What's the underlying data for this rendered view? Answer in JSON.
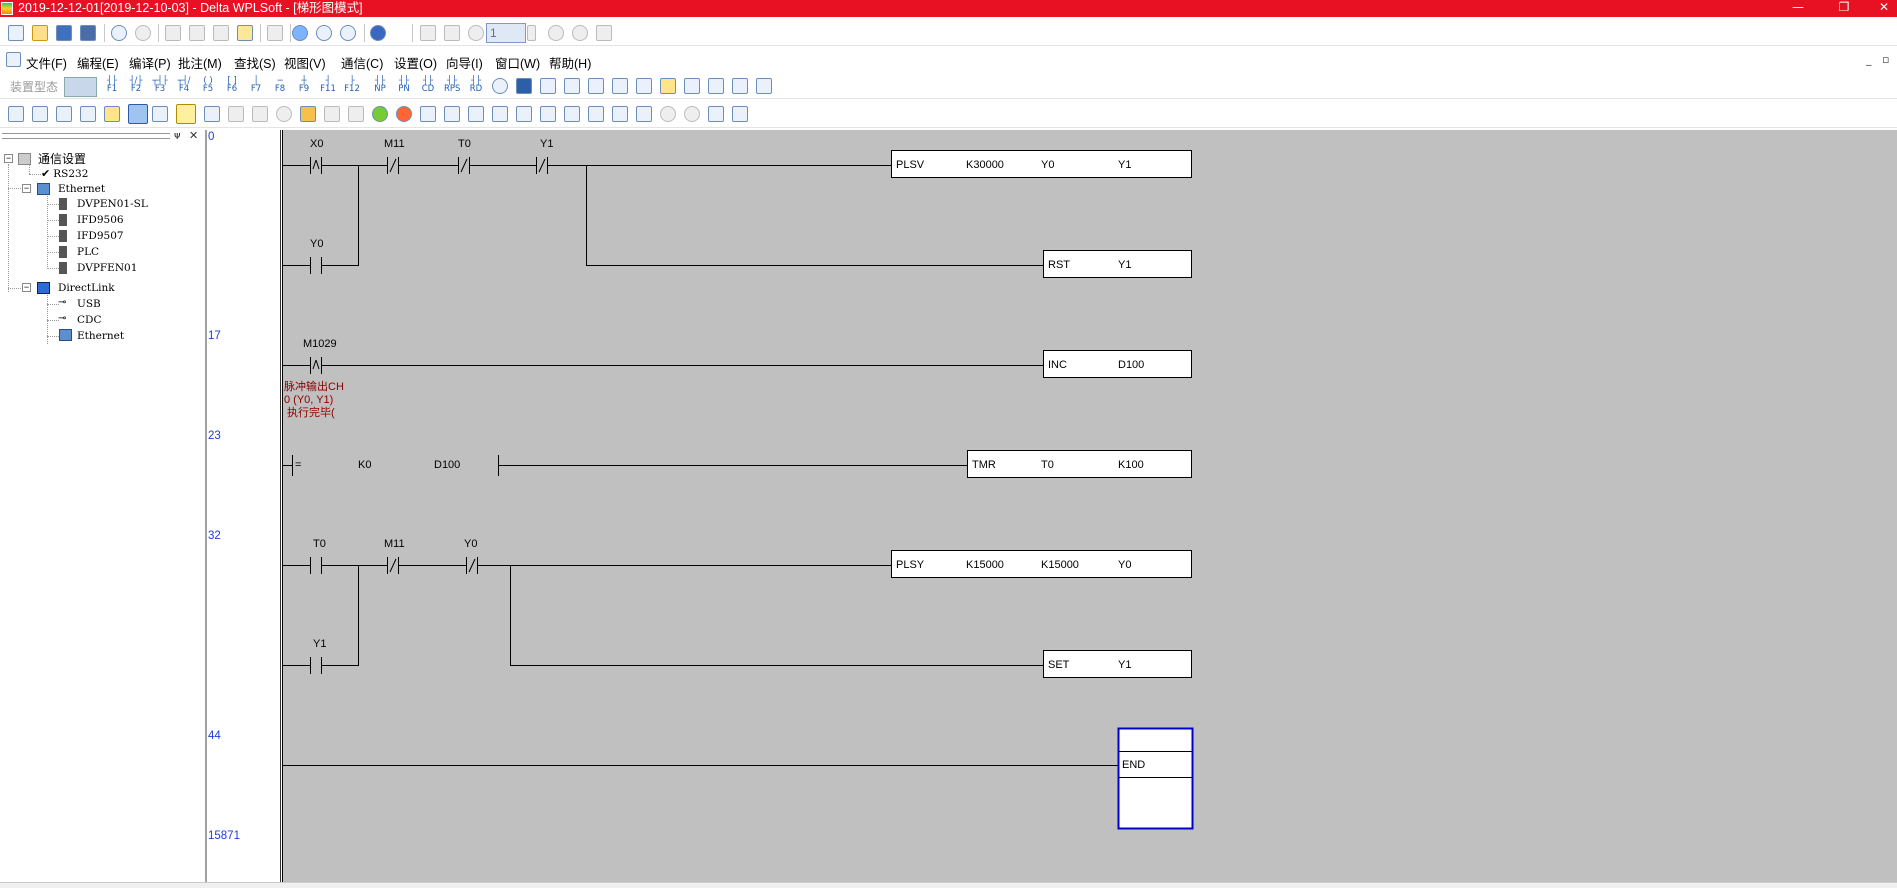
{
  "window": {
    "title": "2019-12-12-01[2019-12-10-03] - Delta WPLSoft - [梯形图模式]",
    "minimize": "—",
    "restore": "❐",
    "close": "✕"
  },
  "toolbar": {
    "position_value": "1"
  },
  "menu": {
    "items": [
      "文件(F)",
      "编程(E)",
      "编译(P)",
      "批注(M)",
      "查找(S)",
      "视图(V)",
      "通信(C)",
      "设置(O)",
      "向导(I)",
      "窗口(W)",
      "帮助(H)"
    ],
    "mdi_min": "_",
    "mdi_restore": "▫"
  },
  "function_bar": {
    "device_type_label": "装置型态",
    "fkeys": [
      "F1",
      "F2",
      "F3",
      "F4",
      "F5",
      "F6",
      "F7",
      "F8",
      "F9",
      "F11",
      "F12",
      "NP",
      "PN",
      "CD",
      "RPS",
      "RD"
    ]
  },
  "comm_tree": {
    "header_pin": "ᴪ",
    "header_close": "✕",
    "root": "通信设置",
    "items": [
      {
        "label": "RS232"
      },
      {
        "label": "Ethernet"
      },
      {
        "label": "DVPEN01-SL"
      },
      {
        "label": "IFD9506"
      },
      {
        "label": "IFD9507"
      },
      {
        "label": "PLC"
      },
      {
        "label": "DVPFEN01"
      },
      {
        "label": "DirectLink"
      },
      {
        "label": "USB"
      },
      {
        "label": "CDC"
      },
      {
        "label": "Ethernet"
      }
    ]
  },
  "line_numbers": [
    "0",
    "17",
    "23",
    "32",
    "44",
    "15871"
  ],
  "ladder": {
    "contacts": {
      "x0": "X0",
      "m11_a": "M11",
      "t0_a": "T0",
      "y1_a": "Y1",
      "y0_a": "Y0",
      "m1029": "M1029",
      "t0_b": "T0",
      "m11_b": "M11",
      "y0_b": "Y0",
      "y1_b": "Y1"
    },
    "comment_lines": [
      "脉冲输出CH",
      "0 (Y0, Y1)",
      "执行完毕("
    ],
    "compare": {
      "op": "=",
      "s1": "K0",
      "s2": "D100"
    },
    "instructions": {
      "plsv": [
        "PLSV",
        "K30000",
        "Y0",
        "Y1"
      ],
      "rst": [
        "RST",
        "Y1"
      ],
      "inc": [
        "INC",
        "D100"
      ],
      "tmr": [
        "TMR",
        "T0",
        "K100"
      ],
      "plsy": [
        "PLSY",
        "K15000",
        "K15000",
        "Y0"
      ],
      "set": [
        "SET",
        "Y1"
      ],
      "end": [
        "END"
      ]
    }
  }
}
